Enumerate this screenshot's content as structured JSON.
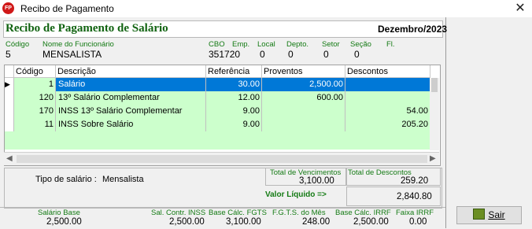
{
  "window": {
    "title": "Recibo de Pagamento",
    "icon_text": "FP",
    "close_glyph": "✕"
  },
  "header": {
    "title": "Recibo de Pagamento de Salário",
    "period": "Dezembro/2023"
  },
  "employee": {
    "labels": {
      "code": "Código",
      "name": "Nome do Funcionário",
      "cbo": "CBO",
      "emp": "Emp.",
      "local": "Local",
      "depto": "Depto.",
      "setor": "Setor",
      "secao": "Seção",
      "fl": "Fl."
    },
    "values": {
      "code": "5",
      "name": "MENSALISTA",
      "cbo": "351720",
      "local": "0",
      "depto": "0",
      "setor": "0",
      "secao": "0"
    }
  },
  "table": {
    "columns": [
      "Código",
      "Descrição",
      "Referência",
      "Proventos",
      "Descontos"
    ],
    "rows": [
      {
        "codigo": "1",
        "descricao": "Salário",
        "referencia": "30.00",
        "proventos": "2,500.00",
        "descontos": ""
      },
      {
        "codigo": "120",
        "descricao": "13º Salário Complementar",
        "referencia": "12.00",
        "proventos": "600.00",
        "descontos": ""
      },
      {
        "codigo": "170",
        "descricao": "INSS 13º Salário Complementar",
        "referencia": "9.00",
        "proventos": "",
        "descontos": "54.00"
      },
      {
        "codigo": "11",
        "descricao": "INSS Sobre Salário",
        "referencia": "9.00",
        "proventos": "",
        "descontos": "205.20"
      }
    ],
    "selected_row": 0
  },
  "summary": {
    "tipo_label": "Tipo de salário :",
    "tipo_value": "Mensalista",
    "total_venc_label": "Total de Vencimentos",
    "total_venc": "3,100.00",
    "total_desc_label": "Total de Descontos",
    "total_desc": "259.20",
    "liquido_label": "Valor Líquido  =>",
    "liquido": "2,840.80"
  },
  "footer": {
    "salario_base_label": "Salário Base",
    "salario_base": "2,500.00",
    "sal_contr_label": "Sal. Contr. INSS",
    "sal_contr": "2,500.00",
    "base_fgts_label": "Base Cálc. FGTS",
    "base_fgts": "3,100.00",
    "fgts_mes_label": "F.G.T.S. do Mês",
    "fgts_mes": "248.00",
    "base_irrf_label": "Base Cálc. IRRF",
    "base_irrf": "2,500.00",
    "faixa_irrf_label": "Faixa IRRF",
    "faixa_irrf": "0.00"
  },
  "buttons": {
    "sair": "Sair"
  },
  "colors": {
    "row_green": "#ccffcc",
    "selected": "#0078d7",
    "label_green": "#137a13",
    "title_green": "#116311"
  }
}
